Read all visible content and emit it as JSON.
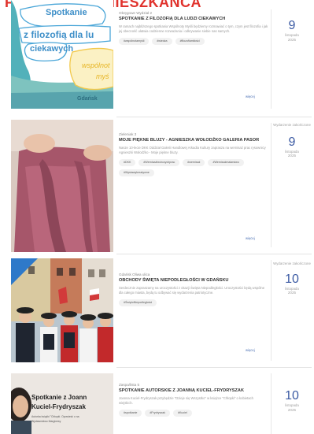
{
  "header": {
    "title": "FOK | KARTA MIESZKAŃCA"
  },
  "events": [
    {
      "venue": "Okręgowe Wydział 2",
      "title": "Spotkanie z filozofią dla ludzi ciekawych",
      "description": "W ramach najbliższego spotkania Wspólnoty Myśli będziemy rozmawiać o tym, czym jest filozofia i jak jej obecność ułatwia codzienne rozważania i odkrywanie siebie nas samych.",
      "tags": [
        "#wspólnotamyśli",
        "#wiedza",
        "#filozofiamiłości"
      ],
      "more_label": "więcej",
      "date_note": "",
      "day": "9",
      "month": "listopada",
      "year": "2025",
      "thumb_kind": "poster",
      "poster": {
        "line1": "Spotkanie",
        "line2": "z filozofią dla lu",
        "line3": "ciekawych",
        "bubble1": "wspólnot",
        "bubble2": "myś",
        "footer": "Gdańsk"
      }
    },
    {
      "venue": "Zieleniak 3",
      "title": "Moje piękne bluzy - Agnieszka Wołodźko Galeria Pasor",
      "description": "Nasze 10-lecie DKK Oddział Galerii Handlowej Arkadia Kultury zaprasza na wernisaż prac rysownicy Agnieszki Wołodźko - Moje piękne bluzy.",
      "tags": [
        "#DKK",
        "#Wernisażtwórczychprac",
        "#wernisaż",
        "#Wernisażmalarstwo",
        "#Wystawykreatywne"
      ],
      "more_label": "więcej",
      "date_note": "Wydarzenie zakończone",
      "day": "9",
      "month": "listopada",
      "year": "2025",
      "thumb_kind": "fabric"
    },
    {
      "venue": "Gdańsk Oliwa ulica",
      "title": "Obchody Święta Niepodległości w Gdańsku",
      "description": "Serdecznie zapraszamy na uroczystości z okazji Święta Niepodległości. Uroczystości będą wspólne dla całego miasta, będą tu odbywać się wydarzenia patriotyczne.",
      "tags": [
        "#ŚwiętoNiepodległości"
      ],
      "more_label": "więcej",
      "date_note": "Wydarzenie zakończone",
      "day": "10",
      "month": "listopada",
      "year": "2025",
      "thumb_kind": "parade"
    },
    {
      "venue": "Zaspa/lista 5",
      "title": "Spotkanie autorskie z Joanną Kuciel-Frydryszak",
      "description": "Joanna Kuciel-Frydryszak przybędzie \"Dzieje się Wszystko\" w książce \"Chłopki\" o kobietach wiejskich.",
      "tags": [
        "#spotkanie",
        "#Frydryszak",
        "#Kuciel"
      ],
      "more_label": "więcej",
      "date_note": "",
      "day": "10",
      "month": "listopada",
      "year": "2025",
      "thumb_kind": "author",
      "author": {
        "line1": "Spotkanie z Joann",
        "line2": "Kuciel-Frydryszak",
        "line3": "Autorka książki \"Chłopki. Opowieść o na",
        "line4": "Wydawnictwo Marginesy"
      }
    }
  ],
  "colors": {
    "accent": "#3b5aa3",
    "header_red": "#e0322c"
  }
}
